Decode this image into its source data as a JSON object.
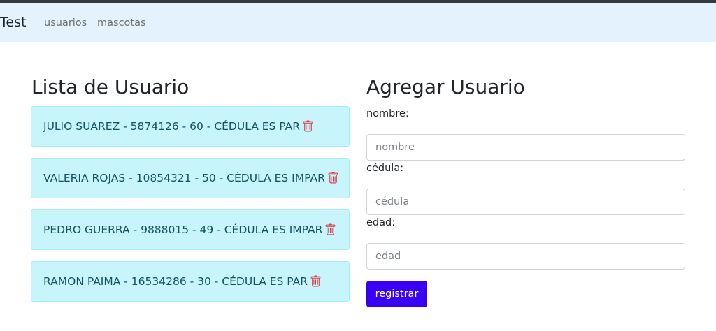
{
  "navbar": {
    "brand": "Test",
    "links": [
      "usuarios",
      "mascotas"
    ]
  },
  "list": {
    "title": "Lista de Usuario",
    "users": [
      "JULIO SUAREZ - 5874126 - 60 - CÉDULA ES PAR",
      "VALERIA ROJAS - 10854321 - 50 - CÉDULA ES IMPAR",
      "PEDRO GUERRA - 9888015 - 49 - CÉDULA ES IMPAR",
      "RAMON PAIMA - 16534286 - 30 - CÉDULA ES PAR"
    ],
    "delete_icon": "trash-icon"
  },
  "form": {
    "title": "Agregar Usuario",
    "fields": [
      {
        "label": "nombre:",
        "placeholder": "nombre",
        "value": ""
      },
      {
        "label": "cédula:",
        "placeholder": "cédula",
        "value": ""
      },
      {
        "label": "edad:",
        "placeholder": "edad",
        "value": ""
      }
    ],
    "submit_label": "registrar"
  },
  "colors": {
    "navbar_bg": "#e3f2fd",
    "item_bg": "#c7f5fb",
    "item_text": "#115362",
    "delete_icon": "#dc3545",
    "button_bg": "#3a00f5"
  }
}
